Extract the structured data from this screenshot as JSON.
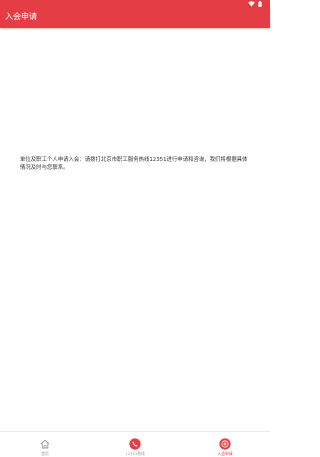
{
  "app_bar": {
    "title": "入会申请",
    "color": "#e53d45"
  },
  "status_bar": {
    "icons": [
      "wifi-icon",
      "battery-icon"
    ]
  },
  "notice": {
    "text": "单位及职工个人申请入会：请拨打北京市职工服务热线12351进行申请和咨询，我们将根据具体情况及时与您联系。"
  },
  "bottom_nav": {
    "items": [
      {
        "label": "首页",
        "icon": "home-icon",
        "active": false
      },
      {
        "label": "12351热线",
        "icon": "phone-icon",
        "active": false
      },
      {
        "label": "入会申请",
        "icon": "membership-icon",
        "active": true
      }
    ]
  }
}
